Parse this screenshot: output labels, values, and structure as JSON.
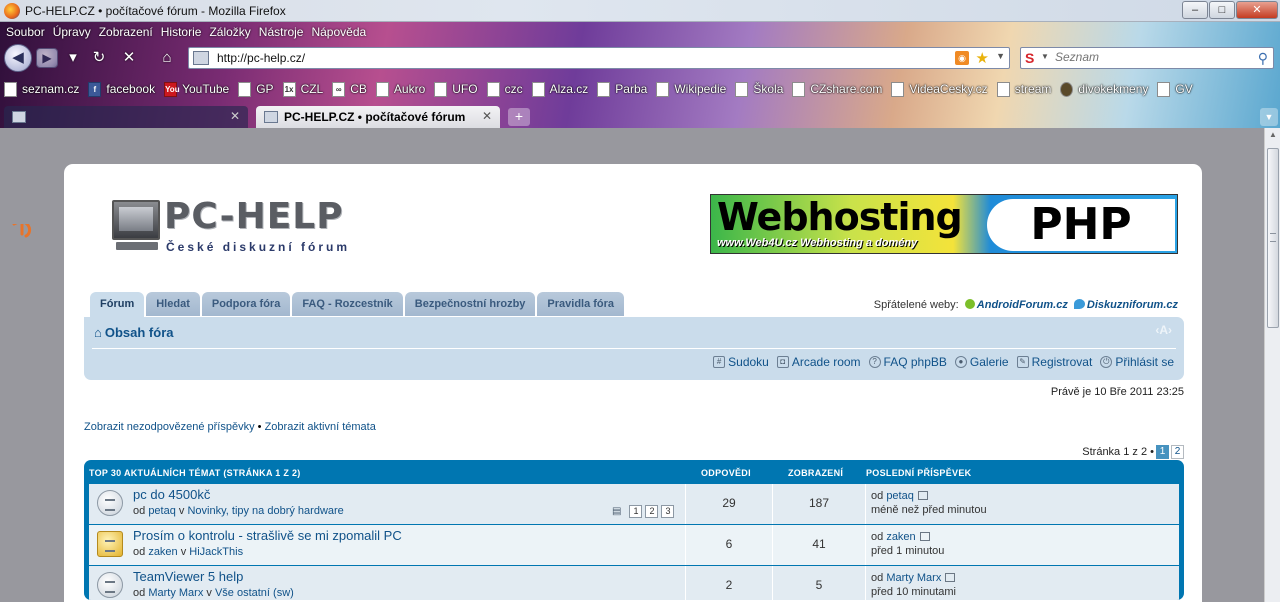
{
  "window": {
    "title": "PC-HELP.CZ • počítačové fórum - Mozilla Firefox",
    "min": "–",
    "max": "□",
    "close": "✕"
  },
  "menu": [
    "Soubor",
    "Úpravy",
    "Zobrazení",
    "Historie",
    "Záložky",
    "Nástroje",
    "Nápověda"
  ],
  "address": {
    "url": "http://pc-help.cz/"
  },
  "search": {
    "engine": "S",
    "placeholder": "Seznam"
  },
  "bookmarks": [
    {
      "label": "seznam.cz",
      "icon": "page-icon"
    },
    {
      "label": "facebook",
      "icon": "facebook-icon",
      "glyph": "f"
    },
    {
      "label": "YouTube",
      "icon": "youtube-icon",
      "glyph": "You"
    },
    {
      "label": "GP",
      "icon": "page-icon"
    },
    {
      "label": "CZL",
      "icon": "czl-icon",
      "glyph": "1x"
    },
    {
      "label": "CB",
      "icon": "cb-icon",
      "glyph": "∞"
    },
    {
      "label": "Aukro",
      "icon": "page-icon"
    },
    {
      "label": "UFO",
      "icon": "page-icon"
    },
    {
      "label": "czc",
      "icon": "page-icon"
    },
    {
      "label": "Alza.cz",
      "icon": "page-icon"
    },
    {
      "label": "Parba",
      "icon": "page-icon"
    },
    {
      "label": "Wikipedie",
      "icon": "page-icon"
    },
    {
      "label": "Škola",
      "icon": "page-icon"
    },
    {
      "label": "CZshare.com",
      "icon": "page-icon"
    },
    {
      "label": "VideaCesky.cz",
      "icon": "page-icon"
    },
    {
      "label": "stream",
      "icon": "page-icon"
    },
    {
      "label": "divokekmeny",
      "icon": "globe-icon"
    },
    {
      "label": "GV",
      "icon": "page-icon"
    }
  ],
  "tabs": [
    {
      "label": "",
      "active": false
    },
    {
      "label": "PC-HELP.CZ • počítačové fórum",
      "active": true
    }
  ],
  "newtab": "+",
  "forum": {
    "logo": {
      "text": "PC-HELP",
      "subtitle": "České diskuzní fórum"
    },
    "banner": {
      "title": "Webhosting",
      "php": "PHP",
      "sub": "www.Web4U.cz  Webhosting a domény"
    },
    "navtabs": [
      "Fórum",
      "Hledat",
      "Podpora fóra",
      "FAQ - Rozcestník",
      "Bezpečnostní hrozby",
      "Pravidla fóra"
    ],
    "friends": {
      "label": "Spřátelené weby:",
      "sites": [
        "AndroidForum.cz",
        "Diskuzniforum.cz"
      ]
    },
    "breadcrumb": "Obsah fóra",
    "fontsize": "‹A›",
    "quicklinks": [
      "Sudoku",
      "Arcade room",
      "FAQ phpBB",
      "Galerie",
      "Registrovat",
      "Přihlásit se"
    ],
    "datetime": "Právě je 10 Bře 2011 23:25",
    "links": {
      "unanswered": "Zobrazit nezodpovězené příspěvky",
      "sep": " • ",
      "active": "Zobrazit aktivní témata"
    },
    "pagination": {
      "label": "Stránka 1 z 2 •",
      "pages": [
        "1",
        "2"
      ],
      "current": "1"
    },
    "table": {
      "headers": [
        "TOP 30 AKTUÁLNÍCH TÉMAT  (STRÁNKA 1 Z 2)",
        "ODPOVĚDI",
        "ZOBRAZENÍ",
        "POSLEDNÍ PŘÍSPĚVEK"
      ],
      "rows": [
        {
          "title": "pc do 4500kč",
          "by": "od",
          "author": "petaq",
          "in": "v",
          "forum": "Novinky, tipy na dobrý hardware",
          "pages": [
            "1",
            "2",
            "3"
          ],
          "replies": "29",
          "views": "187",
          "last_by": "od",
          "last_author": "petaq",
          "last_time": "méně než před minutou",
          "icon": "topic-icon"
        },
        {
          "title": "Prosím o kontrolu - strašlivě se mi zpomalil PC",
          "by": "od",
          "author": "zaken",
          "in": "v",
          "forum": "HiJackThis",
          "pages": [],
          "replies": "6",
          "views": "41",
          "last_by": "od",
          "last_author": "zaken",
          "last_time": "před 1 minutou",
          "icon": "hot-topic-icon"
        },
        {
          "title": "TeamViewer 5 help",
          "by": "od",
          "author": "Marty Marx",
          "in": "v",
          "forum": "Vše ostatní (sw)",
          "pages": [],
          "replies": "2",
          "views": "5",
          "last_by": "od",
          "last_author": "Marty Marx",
          "last_time": "před 10 minutami",
          "icon": "topic-icon"
        }
      ]
    }
  },
  "colors": {
    "link": "#105289",
    "header": "#0076b1",
    "panel": "#cadceb",
    "scribble": "#e8742a"
  }
}
